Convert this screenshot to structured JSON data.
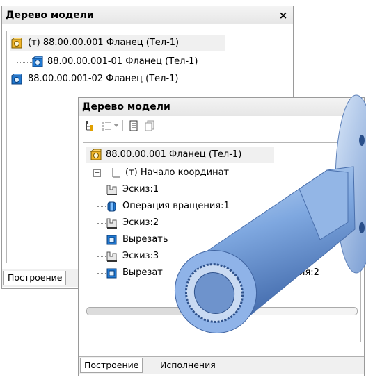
{
  "back_panel": {
    "title": "Дерево модели",
    "close_label": "×",
    "items": [
      {
        "label": "(т) 88.00.00.001 Фланец (Тел-1)"
      },
      {
        "label": "88.00.00.001-01 Фланец (Тел-1)"
      },
      {
        "label": "88.00.00.001-02 Фланец (Тел-1)"
      }
    ],
    "tab_label": "Построение"
  },
  "front_panel": {
    "title": "Дерево модели",
    "close_label": "×",
    "toolbar": {
      "icons": [
        "tree-structure-icon",
        "list-view-icon",
        "dropdown-arrow-icon",
        "document-icon",
        "document-copy-icon"
      ]
    },
    "items": [
      {
        "label": "88.00.00.001 Фланец (Тел-1)",
        "icon": "assembly-icon"
      },
      {
        "label": "(т) Начало координат",
        "icon": "origin-icon",
        "expander": "+"
      },
      {
        "label": "Эскиз:1",
        "icon": "sketch-icon"
      },
      {
        "label": "Операция вращения:1",
        "icon": "rotation-operation-icon"
      },
      {
        "label": "Эскиз:2",
        "icon": "sketch-icon"
      },
      {
        "label": "Вырезать",
        "icon": "cut-icon"
      },
      {
        "label": "Эскиз:3",
        "icon": "sketch-icon"
      },
      {
        "label": "Вырезат",
        "icon": "cut-icon"
      }
    ],
    "partial_label_tail": "ия:2",
    "tabs": [
      {
        "label": "Построение",
        "active": true
      },
      {
        "label": "Исполнения",
        "active": false
      }
    ]
  },
  "colors": {
    "part_blue": "#1f78d1",
    "assembly_orange": "#f0b429",
    "shaft_blue": "#7fa8e0"
  }
}
